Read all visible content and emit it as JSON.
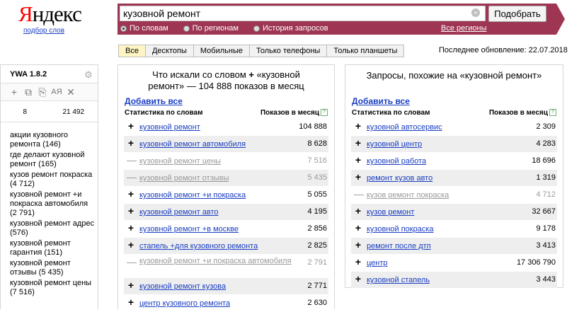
{
  "logo": {
    "first_letter": "Я",
    "rest": "ндекс",
    "sub_link": "подбор слов"
  },
  "search": {
    "value": "кузовной ремонт",
    "button_label": "Подобрать",
    "clear_symbol": "×"
  },
  "radios": [
    {
      "label": "По словам",
      "selected": true
    },
    {
      "label": "По регионам",
      "selected": false
    },
    {
      "label": "История запросов",
      "selected": false
    }
  ],
  "regions_link": "Все регионы",
  "tabs": [
    {
      "label": "Все",
      "active": true
    },
    {
      "label": "Десктопы",
      "active": false
    },
    {
      "label": "Мобильные",
      "active": false
    },
    {
      "label": "Только телефоны",
      "active": false
    },
    {
      "label": "Только планшеты",
      "active": false
    }
  ],
  "updated": "Последнее обновление: 22.07.2018",
  "sidebar": {
    "title": "YWA 1.8.2",
    "count_left": "8",
    "count_right": "21 492",
    "items": [
      "акции кузовного ремонта (146)",
      "где делают кузовной ремонт (165)",
      "кузов ремонт покраска (4 712)",
      "кузовной ремонт +и покраска автомобиля (2 791)",
      "кузовной ремонт адрес (576)",
      "кузовной ремонт гарантия (151)",
      "кузовной ремонт отзывы (5 435)",
      "кузовной ремонт цены (7 516)"
    ]
  },
  "left_panel": {
    "title_line1": "Что искали со словом",
    "title_plus": "+",
    "title_quote": "«кузовной",
    "title_line2": "ремонт» — 104 888 показов в месяц",
    "add_all": "Добавить все",
    "col_keyword": "Статистика по словам",
    "col_count": "Показов в месяц",
    "help": "?",
    "rows": [
      {
        "keyword": "кузовной ремонт",
        "count": "104 888",
        "added": false
      },
      {
        "keyword": "кузовной ремонт автомобиля",
        "count": "8 628",
        "added": false
      },
      {
        "keyword": "кузовной ремонт цены",
        "count": "7 516",
        "added": true
      },
      {
        "keyword": "кузовной ремонт отзывы",
        "count": "5 435",
        "added": true
      },
      {
        "keyword": "кузовной ремонт +и покраска",
        "count": "5 055",
        "added": false
      },
      {
        "keyword": "кузовной ремонт авто",
        "count": "4 195",
        "added": false
      },
      {
        "keyword": "кузовной ремонт +в москве",
        "count": "2 856",
        "added": false
      },
      {
        "keyword": "стапель +для кузовного ремонта",
        "count": "2 825",
        "added": false
      },
      {
        "keyword": "кузовной ремонт +и покраска автомобиля",
        "count": "2 791",
        "added": true
      },
      {
        "keyword": "кузовной ремонт кузова",
        "count": "2 771",
        "added": false
      },
      {
        "keyword": "центр кузовного ремонта",
        "count": "2 630",
        "added": false
      }
    ]
  },
  "right_panel": {
    "title": "Запросы, похожие на «кузовной ремонт»",
    "add_all": "Добавить все",
    "col_keyword": "Статистика по словам",
    "col_count": "Показов в месяц",
    "help": "?",
    "rows": [
      {
        "keyword": "кузовной автосервис",
        "count": "2 309",
        "added": false
      },
      {
        "keyword": "кузовной центр",
        "count": "4 283",
        "added": false
      },
      {
        "keyword": "кузовной работа",
        "count": "18 696",
        "added": false
      },
      {
        "keyword": "ремонт кузов авто",
        "count": "1 319",
        "added": false
      },
      {
        "keyword": "кузов ремонт покраска",
        "count": "4 712",
        "added": true
      },
      {
        "keyword": "кузов ремонт",
        "count": "32 667",
        "added": false
      },
      {
        "keyword": "кузовной покраска",
        "count": "9 178",
        "added": false
      },
      {
        "keyword": "ремонт после дтп",
        "count": "3 413",
        "added": false
      },
      {
        "keyword": "центр",
        "count": "17 306 790",
        "added": false
      },
      {
        "keyword": "кузовной стапель",
        "count": "3 443",
        "added": false
      }
    ]
  },
  "colors": {
    "searchbar": "#9d3553",
    "link": "#1a3dc1",
    "active_tab": "#fff5c4",
    "row_alt": "#eeeeee"
  },
  "icons": {
    "add": "plus-icon",
    "remove": "minus-icon",
    "gear": "gear-icon"
  }
}
